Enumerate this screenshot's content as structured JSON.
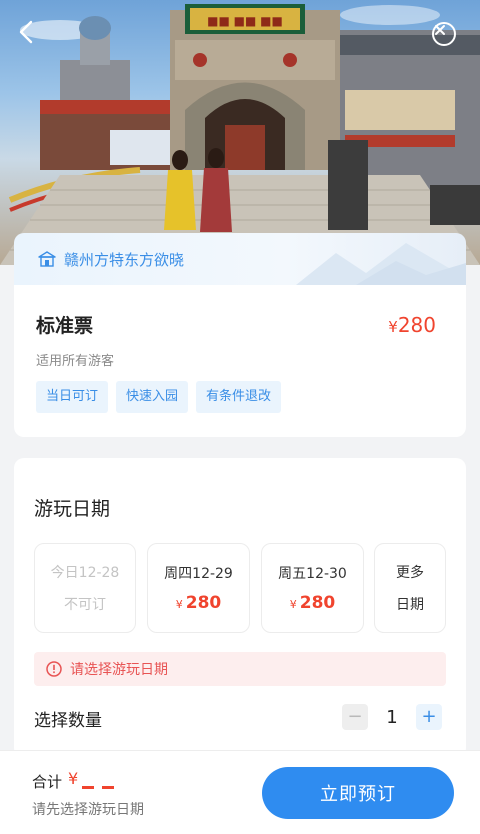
{
  "header": {
    "sign_text": "HENGDIA",
    "colors": {
      "accent": "#2f8cf0",
      "price": "#f0442e",
      "tag_bg": "#eaf4fd",
      "tag_text": "#3a8ee6"
    }
  },
  "scenic": {
    "name": "赣州方特东方欲晓"
  },
  "ticket": {
    "title": "标准票",
    "currency": "¥",
    "price": "280",
    "description": "适用所有游客",
    "tags": [
      "当日可订",
      "快速入园",
      "有条件退改"
    ]
  },
  "booking": {
    "date_section_title": "游玩日期",
    "dates": [
      {
        "label": "今日12-28",
        "sub": "不可订"
      },
      {
        "label": "周四12-29",
        "currency": "¥",
        "price": "280"
      },
      {
        "label": "周五12-30",
        "currency": "¥",
        "price": "280"
      },
      {
        "label": "更多",
        "sub": "日期"
      }
    ],
    "warning": "请选择游玩日期",
    "quantity_label": "选择数量",
    "quantity": "1",
    "minus_symbol": "−",
    "plus_symbol": "+"
  },
  "footer": {
    "total_label": "合计",
    "currency": "¥",
    "hint": "请先选择游玩日期",
    "book_button": "立即预订"
  }
}
